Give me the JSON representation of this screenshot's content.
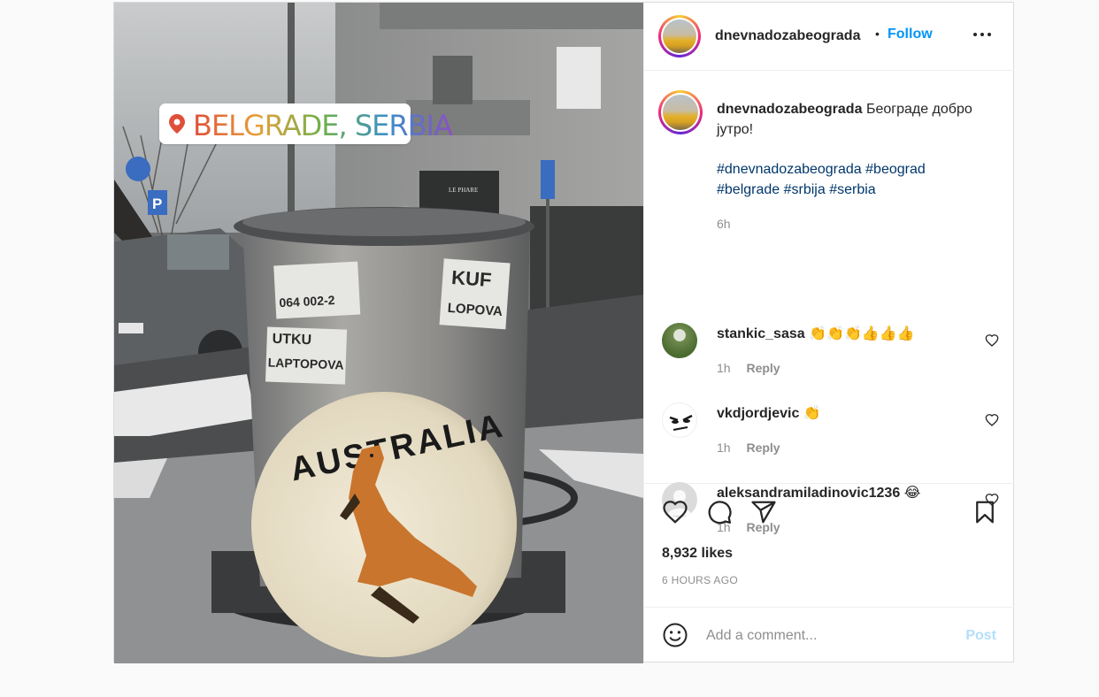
{
  "post": {
    "username": "dnevnadozabeograda",
    "separator": "•",
    "follow_label": "Follow",
    "location_sticker": "BELGRADE, SERBIA",
    "photo_texts": {
      "australia": "AUSTRALIA",
      "sticker_1": "064 002-2",
      "sticker_2": "KUF",
      "sticker_2b": "LOPOVA",
      "sticker_3": "UTKU",
      "sticker_3b": "LAPTOPOVA",
      "shop": "LE PHARE",
      "parking": "P"
    }
  },
  "caption": {
    "username": "dnevnadozabeograda",
    "text_line1": "Београде добро",
    "text_line2": "јутро!",
    "hashtags_line1": [
      "#dnevnadozabeograda",
      "#beograd"
    ],
    "hashtags_line2": [
      "#belgrade",
      "#srbija",
      "#serbia"
    ],
    "time": "6h"
  },
  "comments": [
    {
      "username": "stankic_sasa",
      "text": "👏👏👏👍👍👍",
      "time": "1h",
      "reply": "Reply"
    },
    {
      "username": "vkdjordjevic",
      "text": "👏",
      "time": "1h",
      "reply": "Reply"
    },
    {
      "username": "aleksandramiladinovic1236",
      "text": "😂",
      "time": "1h",
      "reply": "Reply"
    }
  ],
  "stats": {
    "likes": "8,932 likes",
    "time_ago": "6 HOURS AGO"
  },
  "composer": {
    "placeholder": "Add a comment...",
    "post_label": "Post"
  },
  "colors": {
    "follow": "#0095f6",
    "post_disabled": "#b2dffc",
    "hashtag": "#00376b",
    "muted": "#8e8e8e"
  },
  "icons": [
    "location-pin-icon",
    "more-options-icon",
    "heart-icon",
    "comment-icon",
    "share-icon",
    "bookmark-icon",
    "emoji-icon"
  ]
}
